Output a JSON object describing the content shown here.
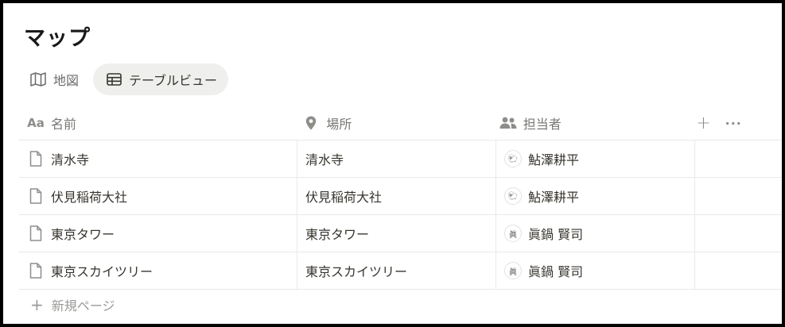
{
  "page": {
    "title": "マップ"
  },
  "views": [
    {
      "label": "地図",
      "icon": "map-icon",
      "active": false
    },
    {
      "label": "テーブルビュー",
      "icon": "table-icon",
      "active": true
    }
  ],
  "table": {
    "columns": [
      {
        "label": "名前",
        "icon": "aa-text-icon"
      },
      {
        "label": "場所",
        "icon": "location-pin-icon"
      },
      {
        "label": "担当者",
        "icon": "people-icon"
      }
    ],
    "add_column_label": "+",
    "more_label": "···",
    "rows": [
      {
        "name": "清水寺",
        "place": "清水寺",
        "assignee": "鮎澤耕平",
        "avatar": "🐑"
      },
      {
        "name": "伏見稲荷大社",
        "place": "伏見稲荷大社",
        "assignee": "鮎澤耕平",
        "avatar": "🐑"
      },
      {
        "name": "東京タワー",
        "place": "東京タワー",
        "assignee": "眞鍋 賢司",
        "avatar": "眞"
      },
      {
        "name": "東京スカイツリー",
        "place": "東京スカイツリー",
        "assignee": "眞鍋 賢司",
        "avatar": "眞"
      }
    ],
    "new_row_label": "新規ページ"
  }
}
